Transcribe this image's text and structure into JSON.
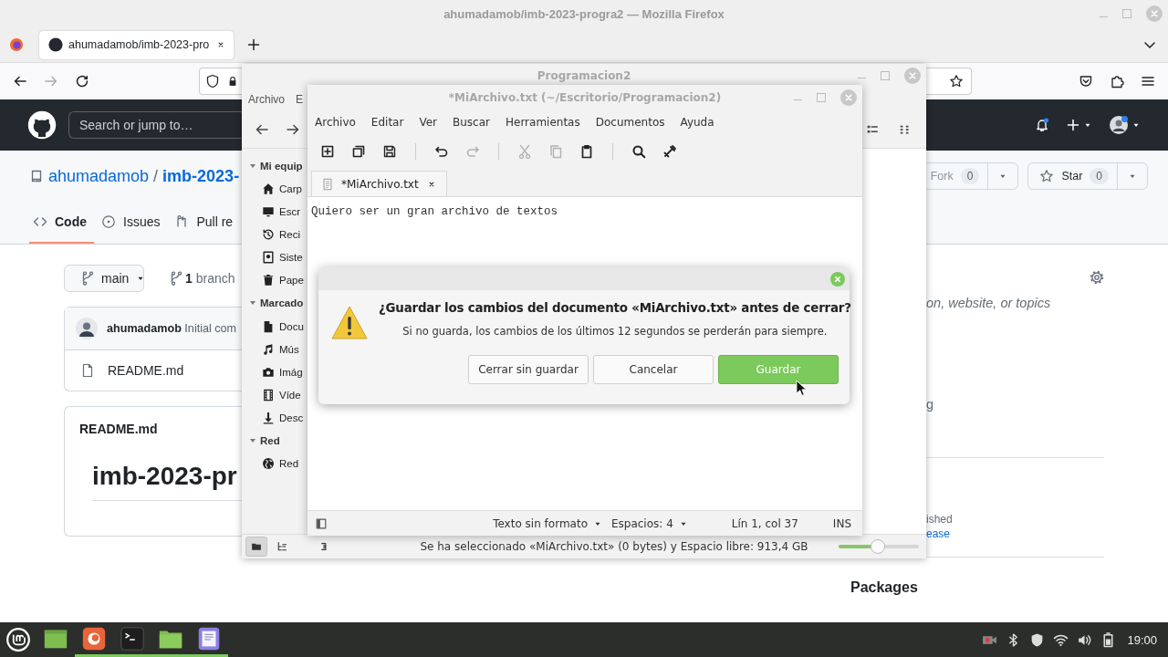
{
  "firefox": {
    "title": "ahumadamob/imb-2023-progra2 — Mozilla Firefox",
    "tab": "ahumadamob/imb-2023-pro"
  },
  "github": {
    "search_placeholder": "Search or jump to…",
    "owner": "ahumadamob",
    "separator": "/",
    "repo": "imb-2023-",
    "fork": {
      "label": "Fork",
      "count": "0"
    },
    "star": {
      "label": "Star",
      "count": "0"
    },
    "tabs": [
      {
        "label": "Code",
        "kind": "code",
        "selected": true
      },
      {
        "label": "Issues",
        "kind": "issues",
        "selected": false
      },
      {
        "label": "Pull re",
        "kind": "pull",
        "selected": false
      }
    ],
    "branch": "main",
    "branches": "**1** branch",
    "commit": "**ahumadamob** Initial com",
    "files": [
      "README.md"
    ],
    "readme": {
      "title": "README.md",
      "heading": "imb-2023-pr"
    },
    "about": [
      "on, website, or topics",
      "g"
    ],
    "releases": [
      {
        "text": "ished",
        "kind": "note"
      },
      {
        "text": "ease",
        "kind": "link"
      }
    ],
    "packages": "Packages"
  },
  "file_manager": {
    "title": "Programacion2",
    "menu": [
      "Archivo",
      "E"
    ],
    "sections": [
      {
        "label": "Mi equip",
        "expanded": true,
        "children": [
          {
            "label": "Carp",
            "kind": "home"
          },
          {
            "label": "Escr",
            "kind": "desktop"
          },
          {
            "label": "Reci",
            "kind": "recent"
          },
          {
            "label": "Siste",
            "kind": "system"
          },
          {
            "label": "Pape",
            "kind": "trash"
          }
        ]
      },
      {
        "label": "Marcado",
        "expanded": true,
        "children": [
          {
            "label": "Docu",
            "kind": "document"
          },
          {
            "label": "Mús",
            "kind": "music"
          },
          {
            "label": "Imág",
            "kind": "camera"
          },
          {
            "label": "Víde",
            "kind": "video"
          },
          {
            "label": "Desc",
            "kind": "download"
          }
        ]
      },
      {
        "label": "Red",
        "expanded": true,
        "children": [
          {
            "label": "Red",
            "kind": "network"
          }
        ]
      }
    ],
    "pane_buttons": [
      {
        "kind": "places",
        "selected": true
      },
      {
        "kind": "tree",
        "selected": false
      },
      {
        "kind": "toggle",
        "selected": false
      }
    ],
    "status": "Se ha seleccionado «MiArchivo.txt» (0 bytes) y Espacio libre: 913,4 GB",
    "zoom": {
      "level": 0.49
    }
  },
  "editor": {
    "title": "*MiArchivo.txt (~/Escritorio/Programacion2)",
    "menu": [
      "Archivo",
      "Editar",
      "Ver",
      "Buscar",
      "Herramientas",
      "Documentos",
      "Ayuda"
    ],
    "toolbar": [
      {
        "kind": "new",
        "disabled": false
      },
      {
        "kind": "open",
        "disabled": false
      },
      {
        "kind": "save",
        "disabled": false
      },
      {
        "kind": "separator"
      },
      {
        "kind": "undo",
        "disabled": false
      },
      {
        "kind": "redo",
        "disabled": true
      },
      {
        "kind": "separator"
      },
      {
        "kind": "cut",
        "disabled": true
      },
      {
        "kind": "copy",
        "disabled": true
      },
      {
        "kind": "paste",
        "disabled": false
      },
      {
        "kind": "separator"
      },
      {
        "kind": "search",
        "disabled": false
      },
      {
        "kind": "tools",
        "disabled": false
      }
    ],
    "tab": "*MiArchivo.txt",
    "text": "Quiero ser un gran archivo de textos",
    "status": {
      "language": "Texto sin formato",
      "indent": "Espacios: 4",
      "position": "Lín 1, col 37",
      "mode": "INS"
    }
  },
  "dialog": {
    "title": "¿Guardar los cambios del documento «MiArchivo.txt» antes de cerrar?",
    "message": "Si no guarda, los cambios de los últimos 12 segundos se perderán para siempre.",
    "buttons": [
      {
        "label": "Cerrar sin guardar",
        "kind": "default"
      },
      {
        "label": "Cancelar",
        "kind": "default"
      },
      {
        "label": "Guardar",
        "kind": "suggested"
      }
    ]
  },
  "taskbar": {
    "apps": [
      {
        "kind": "desktop",
        "running": false
      },
      {
        "kind": "firefox",
        "running": true
      },
      {
        "kind": "terminal",
        "running": true
      },
      {
        "kind": "files",
        "running": true
      },
      {
        "kind": "editor",
        "running": true
      }
    ],
    "clock": "19:00"
  }
}
